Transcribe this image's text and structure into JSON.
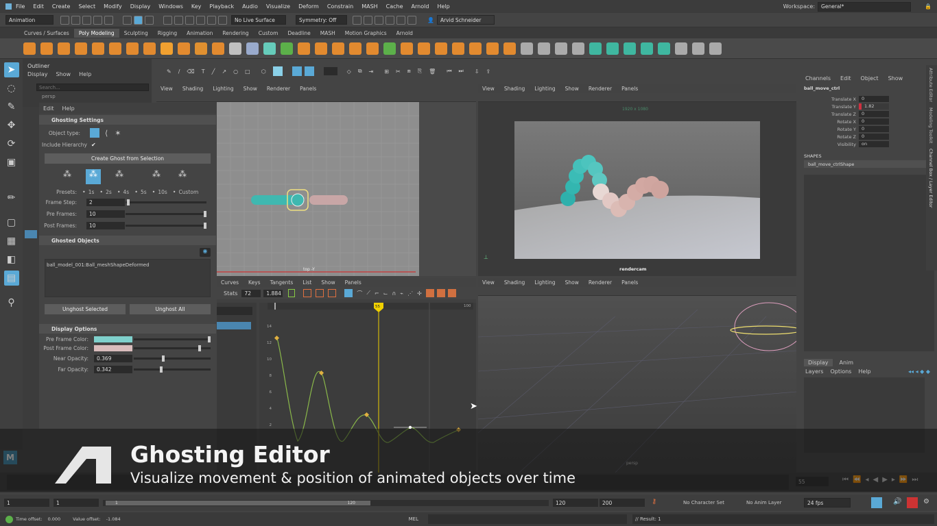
{
  "menubar": {
    "items": [
      "File",
      "Edit",
      "Create",
      "Select",
      "Modify",
      "Display",
      "Windows",
      "Key",
      "Playback",
      "Audio",
      "Visualize",
      "Deform",
      "Constrain",
      "MASH",
      "Cache",
      "Arnold",
      "Help"
    ],
    "workspace_label": "Workspace:",
    "workspace_value": "General*"
  },
  "statusline": {
    "mode": "Animation",
    "live_surface": "No Live Surface",
    "symmetry": "Symmetry: Off",
    "user": "Arvid Schneider"
  },
  "shelf_tabs": [
    "Curves / Surfaces",
    "Poly Modeling",
    "Sculpting",
    "Rigging",
    "Animation",
    "Rendering",
    "Custom",
    "Deadline",
    "MASH",
    "Motion Graphics",
    "Arnold"
  ],
  "outliner": {
    "title": "Outliner",
    "menu": [
      "Display",
      "Show",
      "Help"
    ],
    "search_placeholder": "Search...",
    "item": "persp"
  },
  "ghost": {
    "menu": [
      "Edit",
      "Help"
    ],
    "settings_title": "Ghosting Settings",
    "object_type_label": "Object type:",
    "include_hierarchy_label": "Include Hierarchy",
    "create_button": "Create Ghost from Selection",
    "presets_label": "Presets:",
    "presets": [
      "1s",
      "2s",
      "4s",
      "5s",
      "10s",
      "Custom"
    ],
    "frame_step_label": "Frame Step:",
    "frame_step": "2",
    "pre_frames_label": "Pre Frames:",
    "pre_frames": "10",
    "post_frames_label": "Post Frames:",
    "post_frames": "10",
    "ghosted_title": "Ghosted Objects",
    "ghosted_item": "ball_model_001:Ball_meshShapeDeformed",
    "unghost_selected": "Unghost Selected",
    "unghost_all": "Unghost All",
    "display_title": "Display Options",
    "pre_color_label": "Pre Frame Color:",
    "pre_color": "#7fd0cc",
    "post_color_label": "Post Frame Color:",
    "post_color": "#d9bcbc",
    "near_label": "Near Opacity:",
    "near": "0.369",
    "far_label": "Far Opacity:",
    "far": "0.342"
  },
  "viewport_menu": [
    "View",
    "Shading",
    "Lighting",
    "Show",
    "Renderer",
    "Panels"
  ],
  "viewport_top": {
    "camera": "top -Y"
  },
  "viewport_render": {
    "camera": "rendercam",
    "res": "1920 x 1080"
  },
  "viewport_persp": {
    "camera": "persp"
  },
  "graph": {
    "menu": [
      "Curves",
      "Keys",
      "Tangents",
      "List",
      "Show",
      "Panels"
    ],
    "stats_label": "Stats",
    "stat1": "72",
    "stat2": "1.884",
    "current_frame": "55",
    "end_frame": "100",
    "y_ticks": [
      "14",
      "12",
      "10",
      "8",
      "6",
      "4",
      "2"
    ]
  },
  "channel": {
    "tabs": [
      "Channels",
      "Edit",
      "Object",
      "Show"
    ],
    "node": "ball_move_ctrl",
    "attrs": [
      {
        "name": "Translate X",
        "value": "0"
      },
      {
        "name": "Translate Y",
        "value": "1.82"
      },
      {
        "name": "Translate Z",
        "value": "0"
      },
      {
        "name": "Rotate X",
        "value": "0"
      },
      {
        "name": "Rotate Y",
        "value": "0"
      },
      {
        "name": "Rotate Z",
        "value": "0"
      },
      {
        "name": "Visibility",
        "value": "on"
      }
    ],
    "shapes_label": "SHAPES",
    "shape": "ball_move_ctrlShape",
    "layer_tabs": [
      "Display",
      "Anim"
    ],
    "layer_menu": [
      "Layers",
      "Options",
      "Help"
    ]
  },
  "side_tabs": [
    "Attribute Editor",
    "Modeling Toolkit",
    "Channel Box / Layer Editor"
  ],
  "overlay": {
    "title": "Ghosting Editor",
    "subtitle": "Visualize movement & position of animated objects over time"
  },
  "timeline": {
    "frame": "55"
  },
  "range": {
    "start": "1",
    "inner_start": "1",
    "inner_end": "120",
    "end": "120",
    "max": "200",
    "char_set": "No Character Set",
    "anim_layer": "No Anim Layer",
    "fps": "24 fps"
  },
  "cmdline": {
    "time_offset_label": "Time offset:",
    "time_offset": "0.000",
    "value_offset_label": "Value offset:",
    "value_offset": "-1.084",
    "lang": "MEL",
    "result": "// Result: 1"
  },
  "colors": {
    "accent": "#5aa9d6",
    "playhead": "#f0d000",
    "curve": "#8ab84a",
    "key": "#e0b040"
  }
}
